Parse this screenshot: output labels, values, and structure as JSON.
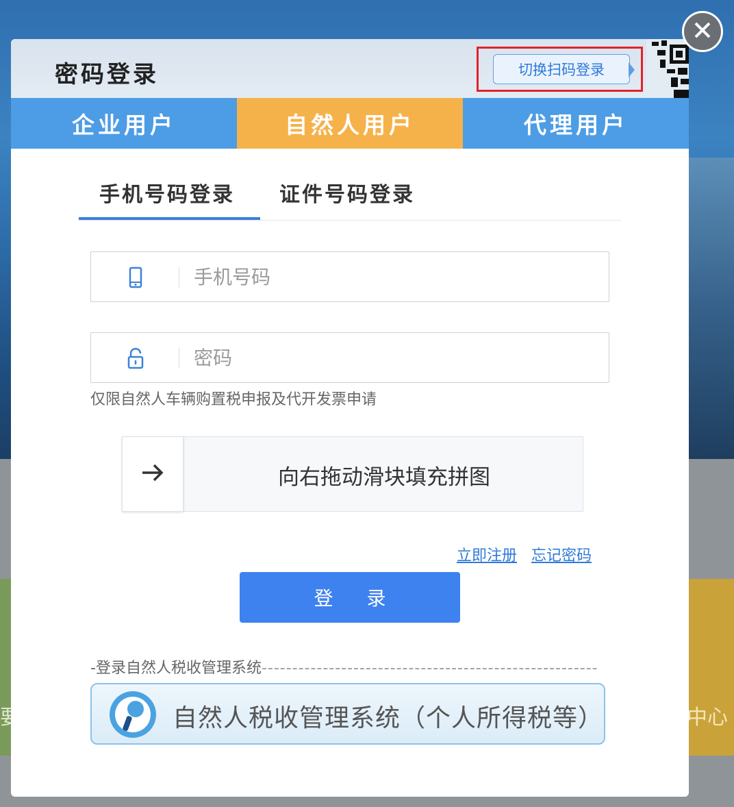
{
  "background": {
    "left_tile_text": "要",
    "right_tile_text": "中心"
  },
  "dialog": {
    "title": "密码登录",
    "switch_button": "切换扫码登录",
    "user_tabs": [
      {
        "label": "企业用户",
        "active": false
      },
      {
        "label": "自然人用户",
        "active": true
      },
      {
        "label": "代理用户",
        "active": false
      }
    ],
    "method_tabs": [
      {
        "label": "手机号码登录",
        "active": true
      },
      {
        "label": "证件号码登录",
        "active": false
      }
    ],
    "phone_input": {
      "placeholder": "手机号码",
      "value": "",
      "icon": "mobile-phone-icon"
    },
    "password_input": {
      "placeholder": "密码",
      "value": "",
      "icon": "lock-icon"
    },
    "note": "仅限自然人车辆购置税申报及代开发票申请",
    "slider": {
      "text": "向右拖动滑块填充拼图",
      "handle_icon": "arrow-right-icon"
    },
    "links": {
      "register": "立即注册",
      "forgot": "忘记密码"
    },
    "login_button": "登 录",
    "system_section": {
      "label": "-登录自然人税收管理系统",
      "dashes": "-------------------------------------------------------------",
      "button_text": "自然人税收管理系统（个人所得税等）"
    }
  },
  "colors": {
    "active_tab": "#f6b24a",
    "inactive_tab": "#4d9ce6",
    "primary": "#3e82ef",
    "highlight_border": "#e0232a"
  }
}
